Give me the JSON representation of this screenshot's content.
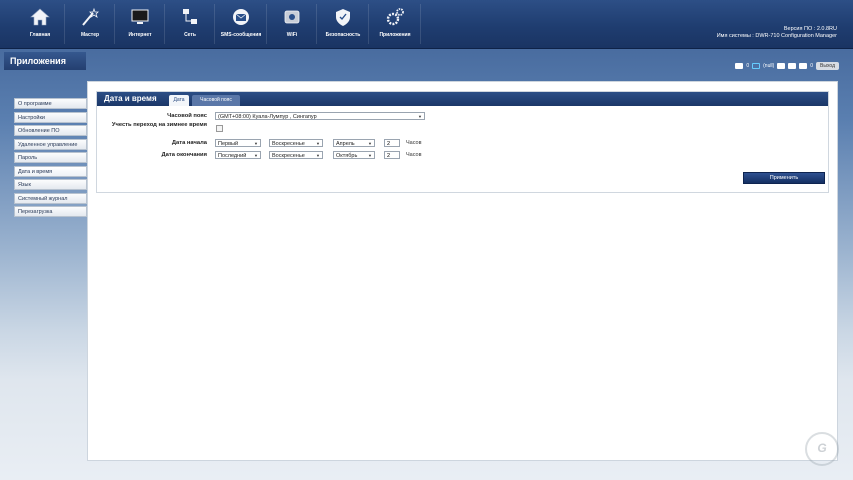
{
  "nav": {
    "items": [
      {
        "label": "Главная",
        "icon": "home-icon"
      },
      {
        "label": "Мастер",
        "icon": "wizard-icon"
      },
      {
        "label": "Интернет",
        "icon": "monitor-icon"
      },
      {
        "label": "Сеть",
        "icon": "network-icon"
      },
      {
        "label": "SMS-сообщения",
        "icon": "envelope-icon"
      },
      {
        "label": "WiFi",
        "icon": "wifi-icon"
      },
      {
        "label": "Безопасность",
        "icon": "shield-icon"
      },
      {
        "label": "Приложения",
        "icon": "gears-icon"
      }
    ]
  },
  "system": {
    "version": "Версия ПО : 2.0.8RU",
    "name": "Имя системы : DWR-710 Configuration Manager"
  },
  "status": {
    "msg_count": "0",
    "signal": "(null)",
    "sms_count": "0",
    "logout": "Выход"
  },
  "sidebar": {
    "title": "Приложения",
    "items": [
      "О программе",
      "Настройки",
      "Обновление ПО",
      "Удаленное управление",
      "Пароль",
      "Дата и время",
      "Язык",
      "Системный журнал",
      "Перезагрузка"
    ]
  },
  "panel": {
    "title": "Дата и время",
    "tabs": {
      "date": "Дата",
      "timezone": "Часовой пояс"
    },
    "fields": {
      "timezone_label": "Часовой пояс",
      "timezone_value": "(GMT+08:00) Куала-Лумпур , Сингапур",
      "dst_label": "Учесть переход на зимнее время",
      "dst_checked": false,
      "start_label": "Дата начала",
      "start_week": "Первый",
      "start_day": "Воскресенье",
      "start_month": "Апрель",
      "start_hour": "2",
      "end_label": "Дата окончания",
      "end_week": "Последний",
      "end_day": "Воскресенье",
      "end_month": "Октябрь",
      "end_hour": "2",
      "hours_unit": "Часов"
    },
    "apply_label": "Применить"
  }
}
